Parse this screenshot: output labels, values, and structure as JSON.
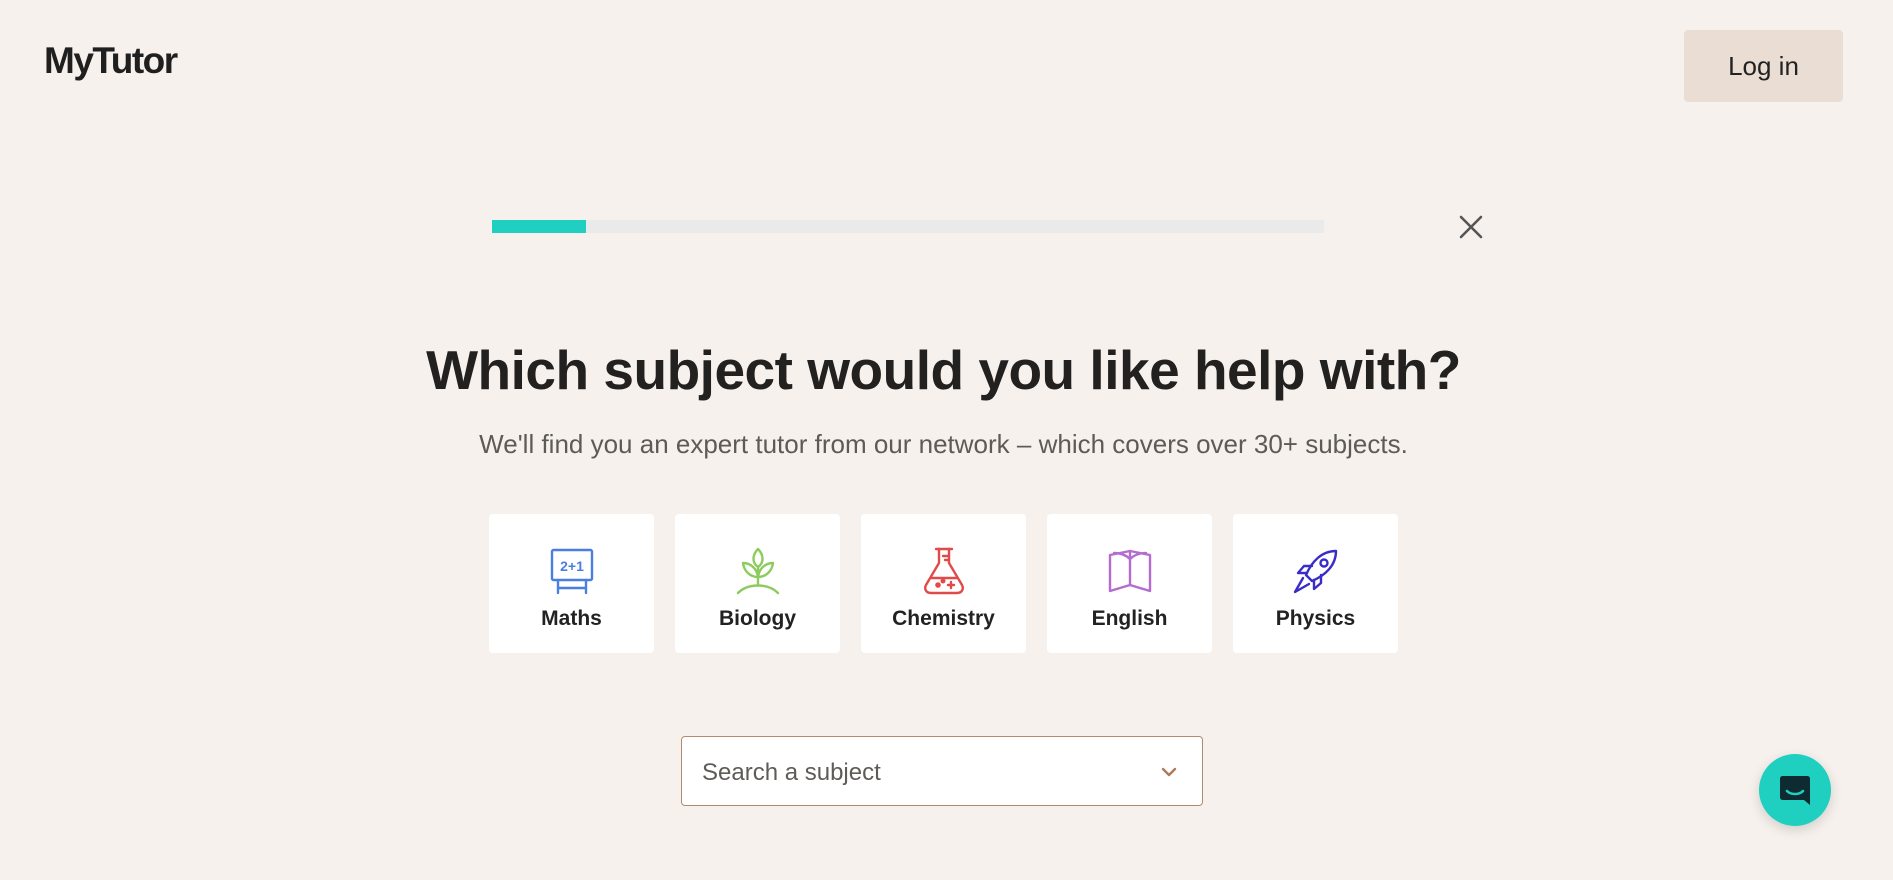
{
  "brand": {
    "logo_text": "MyTutor"
  },
  "header": {
    "login_label": "Log in"
  },
  "progress": {
    "fraction": 0.113,
    "fill_color": "#1fcfbf",
    "track_color": "#eaeaea"
  },
  "close": {
    "icon": "close-icon"
  },
  "main": {
    "title": "Which subject would you like help with?",
    "subtitle": "We'll find you an expert tutor from our network – which covers over 30+ subjects."
  },
  "subjects": [
    {
      "label": "Maths",
      "icon": "whiteboard-icon",
      "color": "#4a7fe0"
    },
    {
      "label": "Biology",
      "icon": "plant-icon",
      "color": "#8ccc5e"
    },
    {
      "label": "Chemistry",
      "icon": "flask-icon",
      "color": "#e24a4a"
    },
    {
      "label": "English",
      "icon": "book-icon",
      "color": "#b56ccf"
    },
    {
      "label": "Physics",
      "icon": "rocket-icon",
      "color": "#3a2cc8"
    }
  ],
  "search": {
    "placeholder": "Search a subject",
    "icon": "chevron-down-icon"
  },
  "chat": {
    "icon": "chat-icon",
    "color": "#1fcfbf"
  },
  "colors": {
    "background": "#f6f1ed",
    "accent": "#1fcfbf",
    "login_bg": "#eaddd4"
  }
}
